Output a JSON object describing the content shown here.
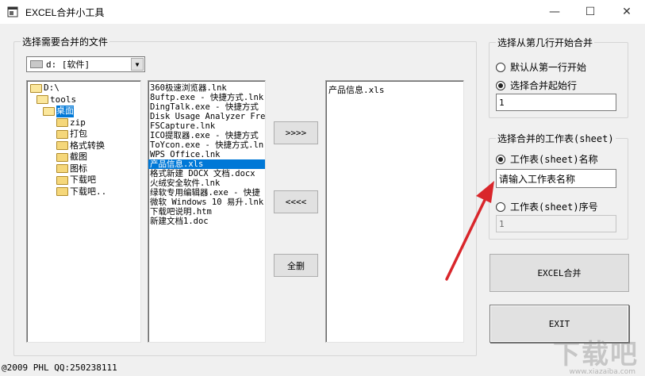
{
  "window": {
    "title": "EXCEL合并小工具",
    "minimize": "—",
    "maximize": "☐",
    "close": "✕"
  },
  "files_group": {
    "legend": "选择需要合并的文件",
    "drive": "d: [软件]",
    "dirs": [
      {
        "label": "D:\\"
      },
      {
        "label": "tools"
      },
      {
        "label": "桌面"
      },
      {
        "label": "zip"
      },
      {
        "label": "打包"
      },
      {
        "label": "格式转换"
      },
      {
        "label": "截图"
      },
      {
        "label": "图标"
      },
      {
        "label": "下载吧"
      },
      {
        "label": "下载吧.."
      }
    ],
    "files": [
      "360极速浏览器.lnk",
      "8uftp.exe - 快捷方式.lnk",
      "DingTalk.exe - 快捷方式",
      "Disk Usage Analyzer Free",
      "FSCapture.lnk",
      "ICO提取器.exe - 快捷方式",
      "ToYcon.exe - 快捷方式.ln",
      "WPS Office.lnk",
      "产品信息.xls",
      "格式新建 DOCX 文档.docx",
      "火绒安全软件.lnk",
      "绿软专用编辑器.exe - 快捷",
      "微软 Windows 10 易升.lnk",
      "下载吧说明.htm",
      "新建文档1.doc"
    ],
    "selected_file_index": 8,
    "add_button": ">>>>",
    "remove_button": "<<<<",
    "clear_button": "全删",
    "selected_files": [
      "产品信息.xls"
    ]
  },
  "start_row_group": {
    "legend": "选择从第几行开始合并",
    "option_first": "默认从第一行开始",
    "option_custom": "选择合并起始行",
    "selected": "custom",
    "start_row_value": "1"
  },
  "sheet_group": {
    "legend": "选择合并的工作表(sheet)",
    "option_name": "工作表(sheet)名称",
    "sheet_name_value": "请输入工作表名称",
    "option_index": "工作表(sheet)序号",
    "sheet_index_value": "1",
    "selected": "name"
  },
  "actions": {
    "merge_button": "EXCEL合并",
    "exit_button": "EXIT"
  },
  "status": {
    "text": "@2009 PHL QQ:250238111"
  },
  "watermark": {
    "text": "下载吧",
    "url": "www.xiazaiba.com"
  },
  "colors": {
    "selection": "#0078d7",
    "arrow": "#d9262b"
  }
}
